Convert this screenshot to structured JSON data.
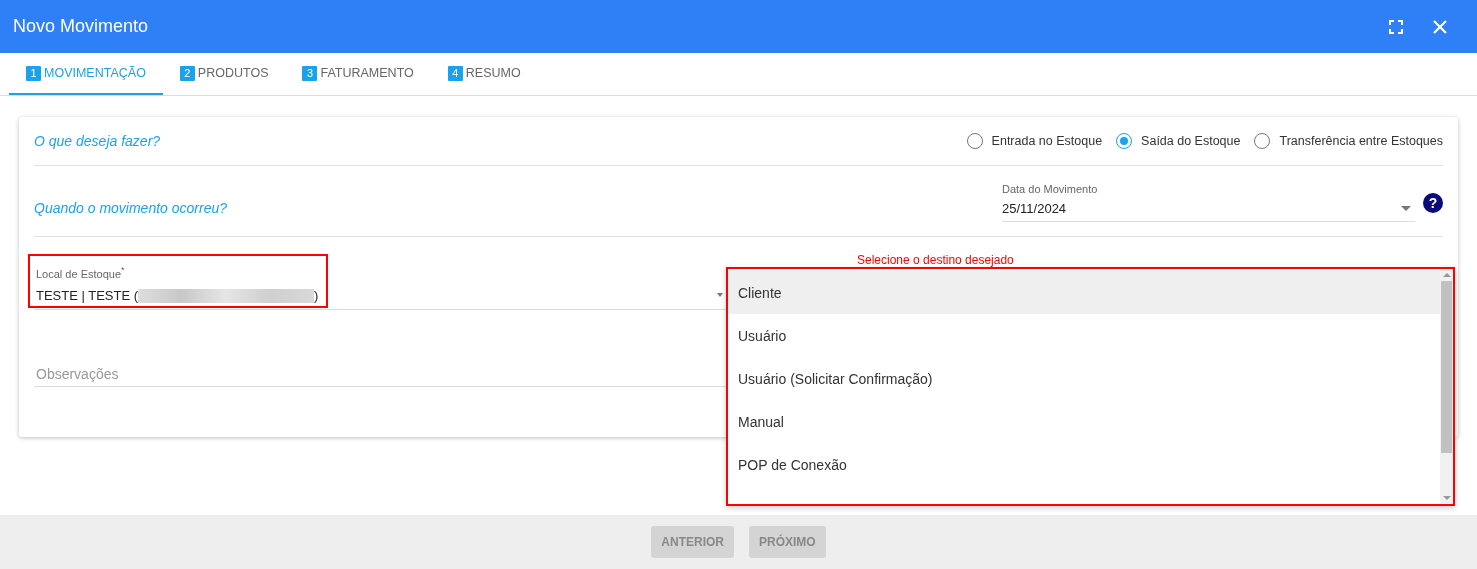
{
  "window": {
    "title": "Novo Movimento"
  },
  "tabs": [
    {
      "number": "1",
      "label": "MOVIMENTAÇÃO",
      "selected": true
    },
    {
      "number": "2",
      "label": "PRODUTOS",
      "selected": false
    },
    {
      "number": "3",
      "label": "FATURAMENTO",
      "selected": false
    },
    {
      "number": "4",
      "label": "RESUMO",
      "selected": false
    }
  ],
  "question": "O que deseja fazer?",
  "movement_types": [
    {
      "label": "Entrada no Estoque",
      "selected": false
    },
    {
      "label": "Saída do Estoque",
      "selected": true
    },
    {
      "label": "Transferência entre Estoques",
      "selected": false
    }
  ],
  "when_question": "Quando o movimento ocorreu?",
  "date_field": {
    "label": "Data do Movimento",
    "value": "25/11/2024"
  },
  "help_button": {
    "label": "?"
  },
  "stock_field": {
    "label": "Local de Estoque",
    "required_mark": "*",
    "value_start": "TESTE | TESTE (",
    "value_end": ")"
  },
  "annotation": "Selecione o destino desejado",
  "destination_options": [
    {
      "label": "Cliente",
      "selected": true
    },
    {
      "label": "Usuário",
      "selected": false
    },
    {
      "label": "Usuário (Solicitar Confirmação)",
      "selected": false
    },
    {
      "label": "Manual",
      "selected": false
    },
    {
      "label": "POP de Conexão",
      "selected": false
    }
  ],
  "notes_field": {
    "placeholder": "Observações"
  },
  "buttons": [
    {
      "label": "ANTERIOR",
      "disabled": true
    },
    {
      "label": "PRÓXIMO",
      "disabled": true
    }
  ]
}
